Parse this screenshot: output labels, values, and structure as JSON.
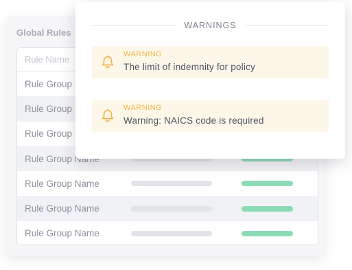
{
  "rules": {
    "title": "Global Rules",
    "column_header": "Rule Name",
    "rows": [
      "Rule Group",
      "Rule Group",
      "Rule Group",
      "Rule Group Name",
      "Rule Group Name",
      "Rule Group Name",
      "Rule Group Name"
    ]
  },
  "warnings": {
    "title": "WARNINGS",
    "items": [
      {
        "label": "WARNING",
        "message": "The limit of indemnity for policy",
        "icon": "bell-icon"
      },
      {
        "label": "WARNING",
        "message": "Warning: NAICS code is required",
        "icon": "bell-icon"
      }
    ]
  },
  "colors": {
    "warning_accent": "#f3b545",
    "warning_bg": "#fdf7ea",
    "status_green": "#8ddbb5",
    "bar_grey": "#e2e4ea"
  }
}
